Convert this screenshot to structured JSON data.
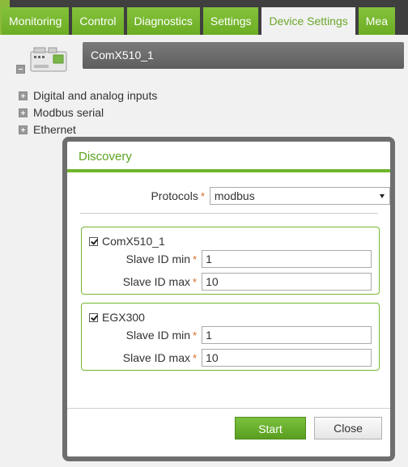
{
  "tabs": [
    {
      "label": "Monitoring",
      "active": false
    },
    {
      "label": "Control",
      "active": false
    },
    {
      "label": "Diagnostics",
      "active": false
    },
    {
      "label": "Settings",
      "active": false
    },
    {
      "label": "Device Settings",
      "active": true
    },
    {
      "label": "Mea",
      "active": false
    }
  ],
  "device": {
    "name": "ComX510_1"
  },
  "tree": {
    "items": [
      {
        "label": "Digital and analog inputs"
      },
      {
        "label": "Modbus serial"
      },
      {
        "label": "Ethernet"
      }
    ]
  },
  "dialog": {
    "title": "Discovery",
    "protocols": {
      "label": "Protocols",
      "required_mark": "*",
      "value": "modbus"
    },
    "groups": [
      {
        "name": "ComX510_1",
        "checked": true,
        "slave_id_min": {
          "label": "Slave ID min",
          "required_mark": "*",
          "value": "1"
        },
        "slave_id_max": {
          "label": "Slave ID max",
          "required_mark": "*",
          "value": "10"
        }
      },
      {
        "name": "EGX300",
        "checked": true,
        "slave_id_min": {
          "label": "Slave ID min",
          "required_mark": "*",
          "value": "1"
        },
        "slave_id_max": {
          "label": "Slave ID max",
          "required_mark": "*",
          "value": "10"
        }
      }
    ],
    "start_label": "Start",
    "close_label": "Close"
  },
  "colors": {
    "accent_green": "#76b72c",
    "title_green": "#5aa21f",
    "dialog_border": "#6e6e6e",
    "required": "#d66a26"
  },
  "icons": {
    "device": "device-module-icon",
    "collapse": "collapse-icon",
    "expand": "expand-icon",
    "checkbox": "checkbox-checked-icon",
    "dropdown": "chevron-down-icon"
  }
}
